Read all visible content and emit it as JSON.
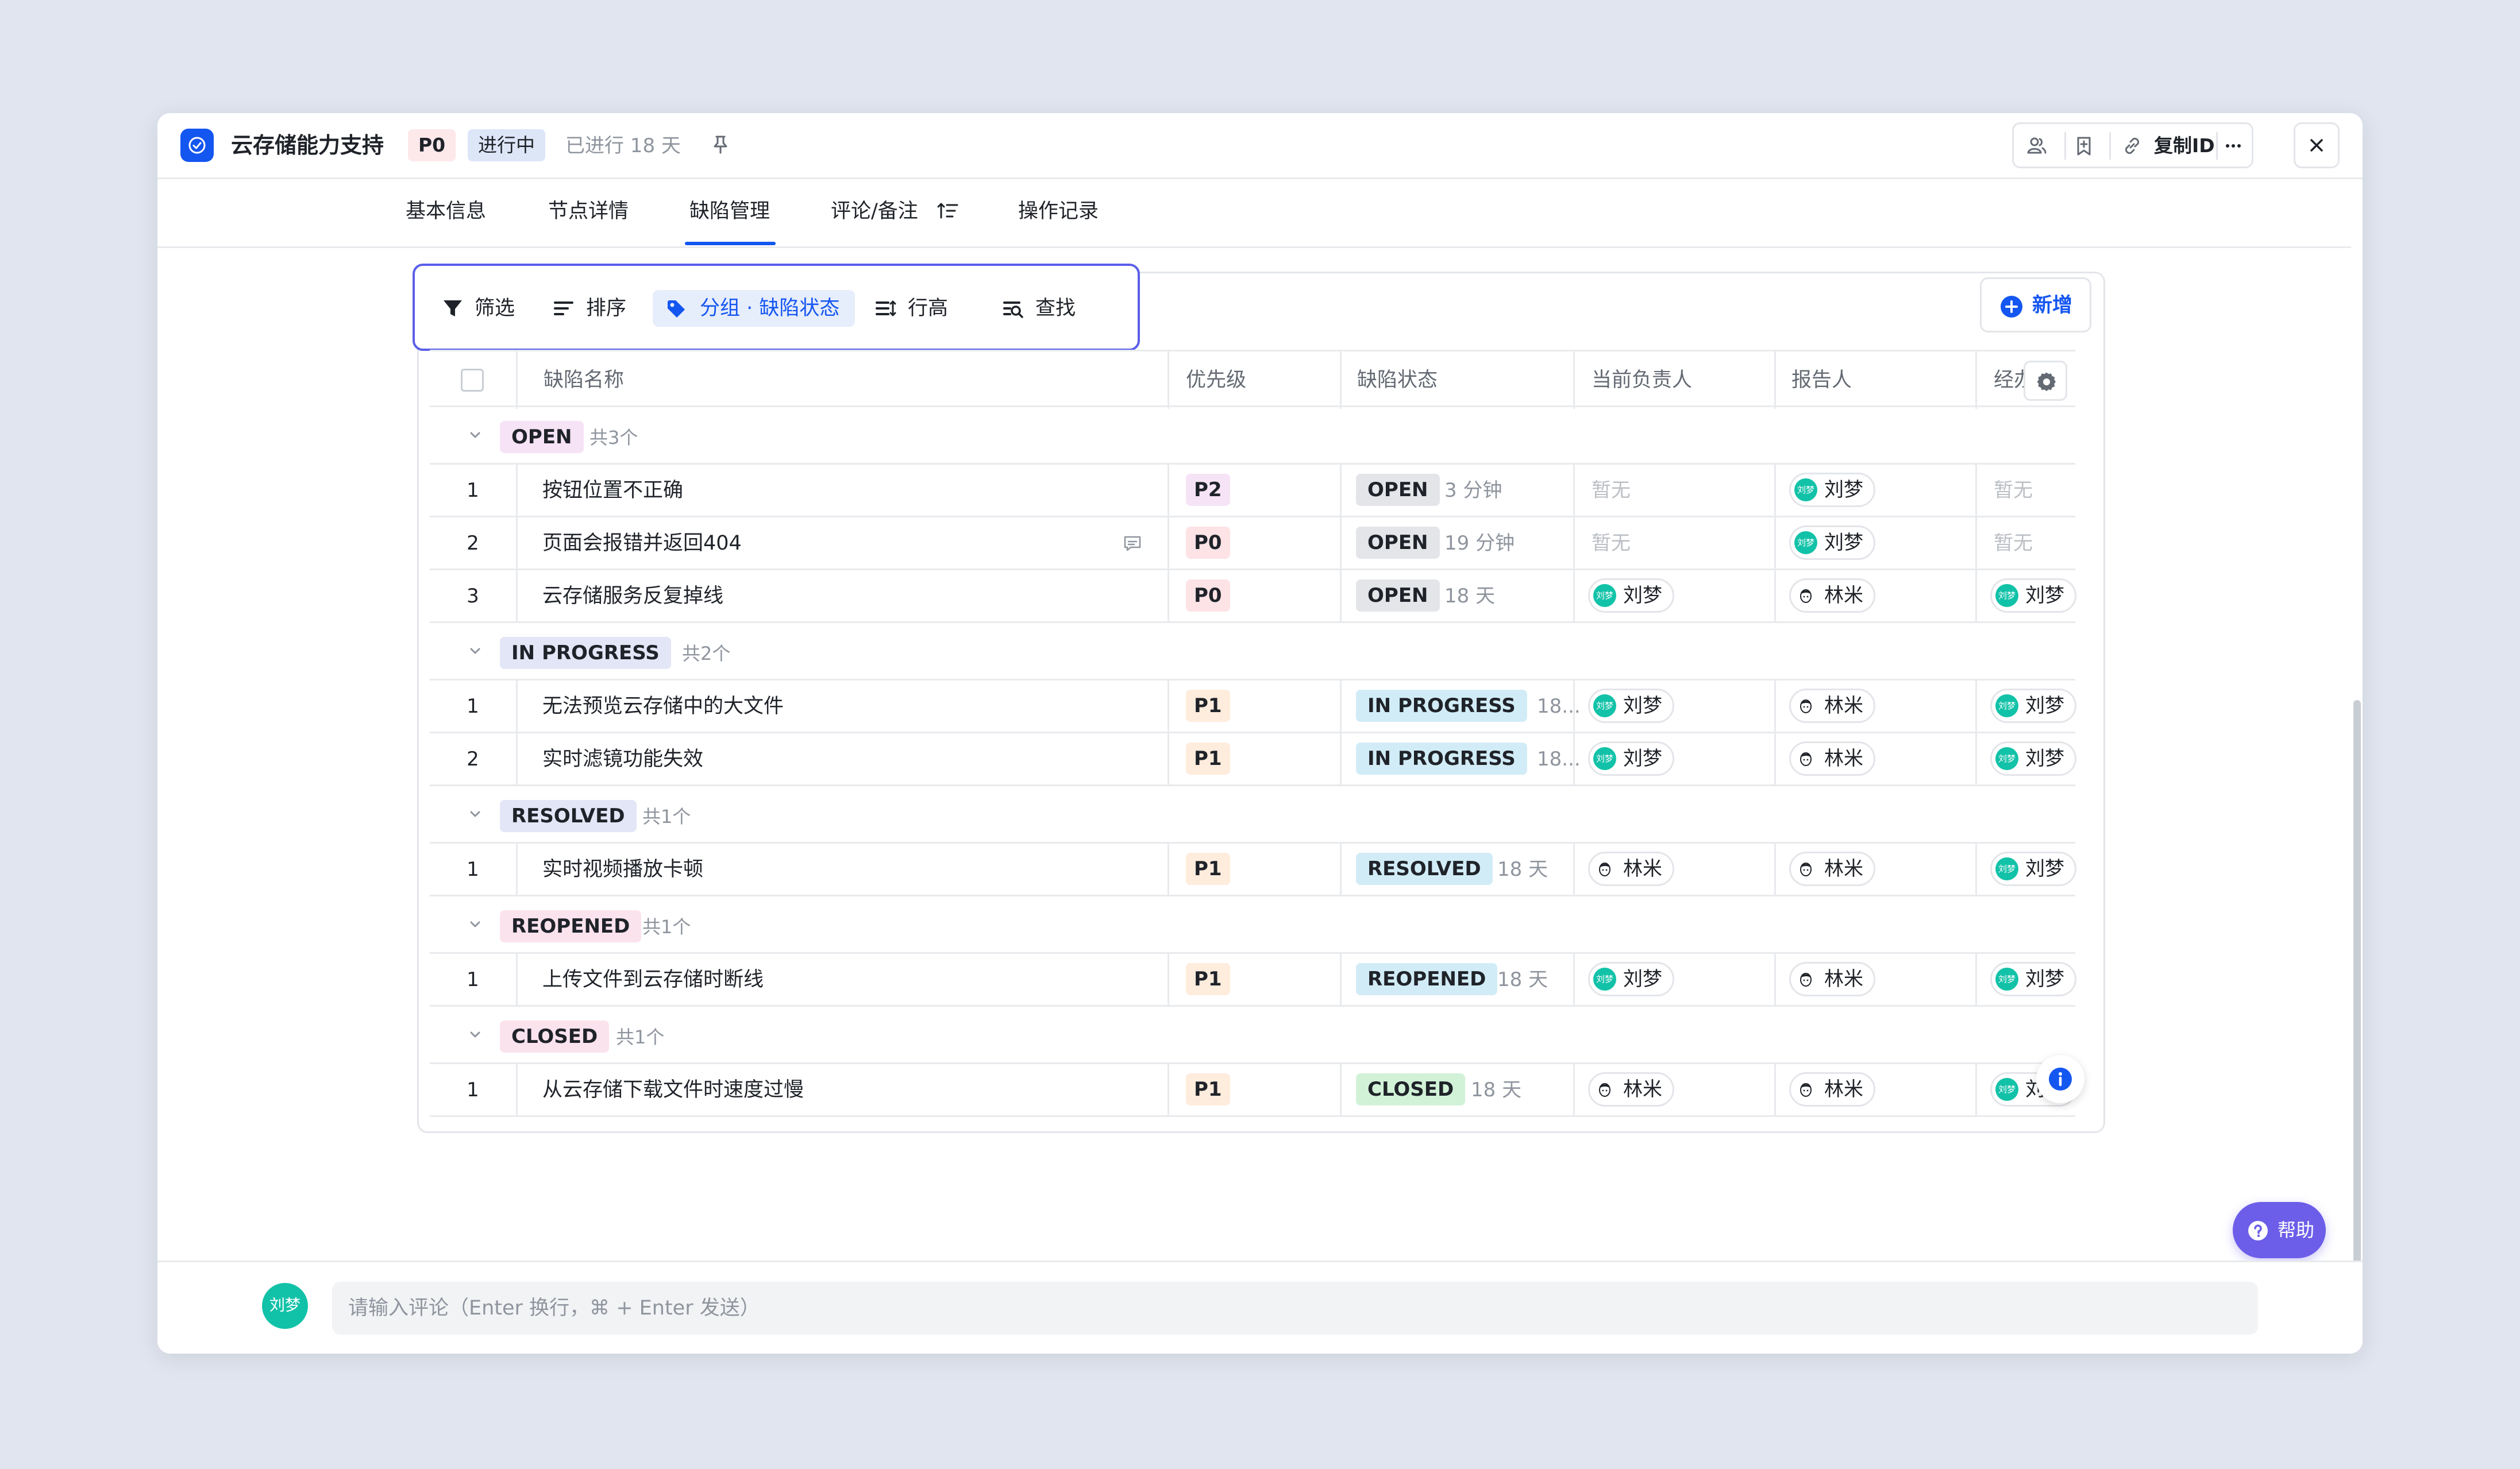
{
  "header": {
    "title": "云存储能力支持",
    "priority": "P0",
    "status": "进行中",
    "elapsed": "已进行 18 天",
    "copy_id": "复制ID"
  },
  "tabs": [
    {
      "label": "基本信息"
    },
    {
      "label": "节点详情"
    },
    {
      "label": "缺陷管理",
      "active": true
    },
    {
      "label": "评论/备注"
    },
    {
      "label": "操作记录"
    }
  ],
  "toolbar": {
    "filter": "筛选",
    "sort": "排序",
    "group": "分组 · 缺陷状态",
    "row_height": "行高",
    "find": "查找",
    "new": "新增"
  },
  "columns": [
    "缺陷名称",
    "优先级",
    "缺陷状态",
    "当前负责人",
    "报告人",
    "经办人"
  ],
  "none_text": "暂无",
  "groups": [
    {
      "name": "OPEN",
      "count": "共3个",
      "color": "#f6e3f6",
      "rows": [
        {
          "idx": "1",
          "name": "按钮位置不正确",
          "priority": "P2",
          "state": "OPEN",
          "time": "3 分钟",
          "owner": "",
          "reporter": "刘梦",
          "handler": ""
        },
        {
          "idx": "2",
          "name": "页面会报错并返回404",
          "comment": true,
          "priority": "P0",
          "state": "OPEN",
          "time": "19 分钟",
          "owner": "",
          "reporter": "刘梦",
          "handler": ""
        },
        {
          "idx": "3",
          "name": "云存储服务反复掉线",
          "priority": "P0",
          "state": "OPEN",
          "time": "18 天",
          "owner": "刘梦",
          "reporter": "林米",
          "handler": "刘梦"
        }
      ]
    },
    {
      "name": "IN PROGRESS",
      "count": "共2个",
      "color": "#e3e6f6",
      "rows": [
        {
          "idx": "1",
          "name": "无法预览云存储中的大文件",
          "priority": "P1",
          "state": "IN PROGRESS",
          "time": "18...",
          "owner": "刘梦",
          "reporter": "林米",
          "handler": "刘梦"
        },
        {
          "idx": "2",
          "name": "实时滤镜功能失效",
          "priority": "P1",
          "state": "IN PROGRESS",
          "time": "18...",
          "owner": "刘梦",
          "reporter": "林米",
          "handler": "刘梦"
        }
      ]
    },
    {
      "name": "RESOLVED",
      "count": "共1个",
      "color": "#e3e6f6",
      "rows": [
        {
          "idx": "1",
          "name": "实时视频播放卡顿",
          "priority": "P1",
          "state": "RESOLVED",
          "time": "18 天",
          "owner": "林米",
          "reporter": "林米",
          "handler": "刘梦"
        }
      ]
    },
    {
      "name": "REOPENED",
      "count": "共1个",
      "color": "#fbe3ee",
      "rows": [
        {
          "idx": "1",
          "name": "上传文件到云存储时断线",
          "priority": "P1",
          "state": "REOPENED",
          "time": "18 天",
          "owner": "刘梦",
          "reporter": "林米",
          "handler": "刘梦"
        }
      ]
    },
    {
      "name": "CLOSED",
      "count": "共1个",
      "color": "#fbe3ee",
      "rows": [
        {
          "idx": "1",
          "name": "从云存储下载文件时速度过慢",
          "priority": "P1",
          "state": "CLOSED",
          "time": "18 天",
          "owner": "林米",
          "reporter": "林米",
          "handler": "刘梦"
        }
      ]
    }
  ],
  "help": "帮助",
  "footer": {
    "avatar_text": "刘梦",
    "placeholder": "请输入评论（Enter 换行，⌘ + Enter 发送）"
  },
  "colors": {
    "accent": "#1456f0",
    "toolbar_outline": "#5b5fe8",
    "help": "#6c5ee8",
    "avatar_green": "#12c2a8"
  }
}
